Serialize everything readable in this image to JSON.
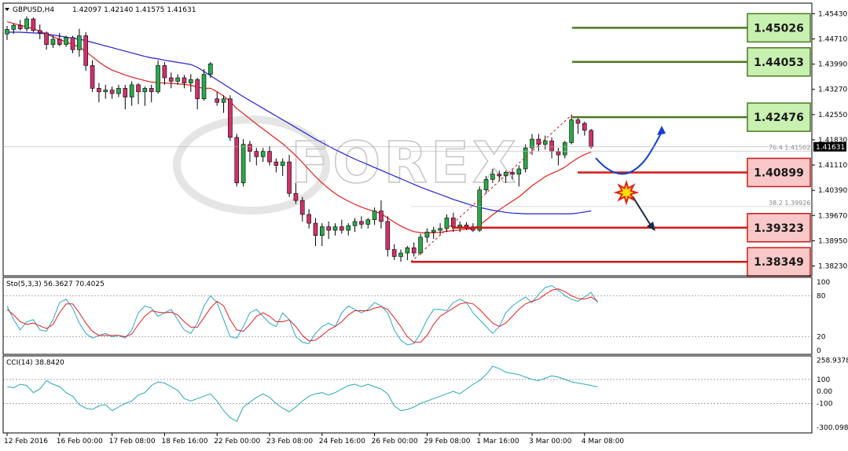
{
  "header": {
    "symbol": "GBPUSD,H4",
    "ohlc": "1.42097 1.42140 1.41575 1.41631"
  },
  "watermark": "FOREX",
  "chart_data": {
    "type": "candlestick",
    "symbol": "GBPUSD",
    "timeframe": "H4",
    "price_axis": {
      "ylim": [
        1.3795,
        1.4573
      ],
      "ticks": [
        "1.45430",
        "1.44710",
        "1.43990",
        "1.43270",
        "1.42550",
        "1.41830",
        "1.41110",
        "1.40390",
        "1.39670",
        "1.38950",
        "1.38230"
      ],
      "current_price": "1.41631"
    },
    "time_axis": {
      "labels": [
        "12 Feb 2016",
        "16 Feb 00:00",
        "17 Feb 08:00",
        "18 Feb 16:00",
        "22 Feb 00:00",
        "23 Feb 08:00",
        "24 Feb 16:00",
        "26 Feb 00:00",
        "29 Feb 08:00",
        "1 Mar 16:00",
        "3 Mar 00:00",
        "4 Mar 08:00"
      ],
      "label_bar_index": [
        0,
        8,
        16,
        24,
        32,
        40,
        48,
        56,
        64,
        72,
        80,
        88
      ]
    },
    "candles": [
      [
        1.4485,
        1.4508,
        1.4468,
        1.4498
      ],
      [
        1.4498,
        1.4515,
        1.4486,
        1.451
      ],
      [
        1.451,
        1.4525,
        1.4495,
        1.45
      ],
      [
        1.45,
        1.4535,
        1.4492,
        1.4528
      ],
      [
        1.4528,
        1.4532,
        1.449,
        1.4495
      ],
      [
        1.4495,
        1.4512,
        1.447,
        1.4488
      ],
      [
        1.4488,
        1.4492,
        1.444,
        1.4455
      ],
      [
        1.4455,
        1.448,
        1.4445,
        1.447
      ],
      [
        1.447,
        1.4488,
        1.445,
        1.4455
      ],
      [
        1.4455,
        1.448,
        1.4448,
        1.4475
      ],
      [
        1.4475,
        1.448,
        1.443,
        1.444
      ],
      [
        1.444,
        1.45,
        1.442,
        1.448
      ],
      [
        1.448,
        1.449,
        1.438,
        1.4395
      ],
      [
        1.4395,
        1.441,
        1.432,
        1.433
      ],
      [
        1.433,
        1.4345,
        1.429,
        1.432
      ],
      [
        1.432,
        1.434,
        1.43,
        1.4325
      ],
      [
        1.4325,
        1.4335,
        1.43,
        1.4315
      ],
      [
        1.4315,
        1.434,
        1.4305,
        1.433
      ],
      [
        1.433,
        1.434,
        1.427,
        1.4305
      ],
      [
        1.4305,
        1.435,
        1.428,
        1.434
      ],
      [
        1.434,
        1.4345,
        1.4285,
        1.432
      ],
      [
        1.432,
        1.4335,
        1.428,
        1.433
      ],
      [
        1.433,
        1.434,
        1.429,
        1.432
      ],
      [
        1.432,
        1.441,
        1.4315,
        1.4395
      ],
      [
        1.4395,
        1.4405,
        1.434,
        1.436
      ],
      [
        1.436,
        1.4375,
        1.433,
        1.435
      ],
      [
        1.435,
        1.437,
        1.434,
        1.436
      ],
      [
        1.436,
        1.4368,
        1.433,
        1.4345
      ],
      [
        1.4345,
        1.437,
        1.432,
        1.4355
      ],
      [
        1.4355,
        1.436,
        1.427,
        1.43
      ],
      [
        1.43,
        1.4385,
        1.4295,
        1.437
      ],
      [
        1.437,
        1.4405,
        1.436,
        1.44
      ],
      [
        1.43,
        1.432,
        1.428,
        1.429
      ],
      [
        1.429,
        1.431,
        1.426,
        1.43
      ],
      [
        1.43,
        1.431,
        1.418,
        1.419
      ],
      [
        1.419,
        1.42,
        1.405,
        1.406
      ],
      [
        1.406,
        1.4185,
        1.405,
        1.417
      ],
      [
        1.417,
        1.418,
        1.412,
        1.415
      ],
      [
        1.415,
        1.416,
        1.411,
        1.4135
      ],
      [
        1.4135,
        1.416,
        1.412,
        1.415
      ],
      [
        1.415,
        1.4165,
        1.411,
        1.412
      ],
      [
        1.412,
        1.413,
        1.409,
        1.411
      ],
      [
        1.411,
        1.413,
        1.408,
        1.412
      ],
      [
        1.412,
        1.414,
        1.402,
        1.403
      ],
      [
        1.403,
        1.406,
        1.4,
        1.401
      ],
      [
        1.401,
        1.402,
        1.395,
        1.397
      ],
      [
        1.397,
        1.3985,
        1.393,
        1.3945
      ],
      [
        1.3945,
        1.396,
        1.388,
        1.391
      ],
      [
        1.391,
        1.3945,
        1.388,
        1.3935
      ],
      [
        1.3935,
        1.395,
        1.39,
        1.3925
      ],
      [
        1.3925,
        1.3945,
        1.391,
        1.3935
      ],
      [
        1.3935,
        1.3955,
        1.3915,
        1.3925
      ],
      [
        1.3925,
        1.3945,
        1.391,
        1.3938
      ],
      [
        1.3938,
        1.396,
        1.392,
        1.395
      ],
      [
        1.395,
        1.3965,
        1.393,
        1.3942
      ],
      [
        1.3942,
        1.396,
        1.393,
        1.3955
      ],
      [
        1.3955,
        1.399,
        1.394,
        1.398
      ],
      [
        1.398,
        1.401,
        1.393,
        1.395
      ],
      [
        1.395,
        1.3965,
        1.385,
        1.387
      ],
      [
        1.387,
        1.3885,
        1.384,
        1.385
      ],
      [
        1.385,
        1.387,
        1.3835,
        1.386
      ],
      [
        1.386,
        1.388,
        1.384,
        1.3875
      ],
      [
        1.3875,
        1.389,
        1.385,
        1.386
      ],
      [
        1.386,
        1.3915,
        1.3855,
        1.3905
      ],
      [
        1.3905,
        1.393,
        1.389,
        1.392
      ],
      [
        1.392,
        1.3935,
        1.39,
        1.3925
      ],
      [
        1.3925,
        1.3945,
        1.391,
        1.393
      ],
      [
        1.393,
        1.397,
        1.392,
        1.396
      ],
      [
        1.396,
        1.3975,
        1.392,
        1.3935
      ],
      [
        1.3935,
        1.395,
        1.392,
        1.394
      ],
      [
        1.394,
        1.3948,
        1.3925,
        1.3935
      ],
      [
        1.3935,
        1.3945,
        1.392,
        1.3925
      ],
      [
        1.3925,
        1.405,
        1.392,
        1.404
      ],
      [
        1.404,
        1.408,
        1.403,
        1.407
      ],
      [
        1.407,
        1.41,
        1.406,
        1.4085
      ],
      [
        1.4085,
        1.4095,
        1.4065,
        1.408
      ],
      [
        1.408,
        1.4095,
        1.406,
        1.409
      ],
      [
        1.409,
        1.41,
        1.407,
        1.4085
      ],
      [
        1.4085,
        1.411,
        1.405,
        1.41
      ],
      [
        1.41,
        1.417,
        1.409,
        1.416
      ],
      [
        1.416,
        1.42,
        1.414,
        1.4185
      ],
      [
        1.4185,
        1.42,
        1.415,
        1.417
      ],
      [
        1.417,
        1.4195,
        1.4155,
        1.418
      ],
      [
        1.418,
        1.419,
        1.413,
        1.415
      ],
      [
        1.415,
        1.416,
        1.411,
        1.414
      ],
      [
        1.414,
        1.418,
        1.413,
        1.4175
      ],
      [
        1.4175,
        1.4255,
        1.417,
        1.424
      ],
      [
        1.424,
        1.425,
        1.42,
        1.423
      ],
      [
        1.423,
        1.4235,
        1.4195,
        1.421
      ],
      [
        1.421,
        1.4214,
        1.4158,
        1.4163
      ]
    ],
    "indicators": {
      "ma_fast": {
        "color": "#e02020",
        "values": [
          1.452,
          1.4515,
          1.451,
          1.4505,
          1.45,
          1.4493,
          1.4485,
          1.4477,
          1.447,
          1.4462,
          1.4455,
          1.4448,
          1.4435,
          1.442,
          1.4405,
          1.4392,
          1.4382,
          1.4375,
          1.4368,
          1.4362,
          1.4357,
          1.4352,
          1.4348,
          1.4346,
          1.4345,
          1.4344,
          1.4343,
          1.4341,
          1.4339,
          1.4333,
          1.433,
          1.433,
          1.432,
          1.4308,
          1.4292,
          1.4272,
          1.4258,
          1.4243,
          1.4228,
          1.4214,
          1.42,
          1.4186,
          1.4172,
          1.4155,
          1.4138,
          1.4118,
          1.4098,
          1.4078,
          1.406,
          1.4044,
          1.403,
          1.4018,
          1.4008,
          1.3999,
          1.3991,
          1.3984,
          1.3979,
          1.3972,
          1.396,
          1.3948,
          1.3937,
          1.3928,
          1.3921,
          1.3918,
          1.3917,
          1.3918,
          1.3919,
          1.3922,
          1.3924,
          1.3926,
          1.3928,
          1.3929,
          1.394,
          1.3954,
          1.3969,
          1.3983,
          1.3996,
          1.4008,
          1.402,
          1.4036,
          1.4052,
          1.4065,
          1.4078,
          1.4087,
          1.4095,
          1.4105,
          1.4119,
          1.4131,
          1.4141,
          1.4148
        ]
      },
      "ma_slow": {
        "color": "#2020d0",
        "values": [
          1.449,
          1.449,
          1.449,
          1.4489,
          1.4488,
          1.4487,
          1.4485,
          1.4482,
          1.4479,
          1.4476,
          1.4473,
          1.447,
          1.4466,
          1.4461,
          1.4456,
          1.4451,
          1.4446,
          1.4441,
          1.4436,
          1.4431,
          1.4426,
          1.4421,
          1.4417,
          1.4414,
          1.441,
          1.4407,
          1.4404,
          1.4401,
          1.4398,
          1.439,
          1.4378,
          1.4366,
          1.4354,
          1.4342,
          1.433,
          1.4318,
          1.4306,
          1.4295,
          1.4284,
          1.4273,
          1.4262,
          1.4251,
          1.424,
          1.4229,
          1.4218,
          1.4207,
          1.4196,
          1.4185,
          1.4175,
          1.4165,
          1.4155,
          1.4146,
          1.4137,
          1.4128,
          1.412,
          1.4112,
          1.4104,
          1.4096,
          1.4088,
          1.408,
          1.4072,
          1.4064,
          1.4056,
          1.4048,
          1.4041,
          1.4034,
          1.4027,
          1.402,
          1.4013,
          1.4007,
          1.4001,
          1.3995,
          1.399,
          1.3986,
          1.3982,
          1.3979,
          1.3976,
          1.3974,
          1.3973,
          1.3972,
          1.3972,
          1.3972,
          1.3972,
          1.3972,
          1.3972,
          1.3972,
          1.3972,
          1.3974,
          1.3977,
          1.398
        ]
      }
    },
    "levels": [
      {
        "label": "1.45026",
        "value": 1.45026,
        "kind": "resistance",
        "color": "#4a7a20",
        "fill": "#c8f0b0"
      },
      {
        "label": "1.44053",
        "value": 1.44053,
        "kind": "resistance",
        "color": "#4a7a20",
        "fill": "#c8f0b0"
      },
      {
        "label": "1.42476",
        "value": 1.42476,
        "kind": "resistance",
        "color": "#4a7a20",
        "fill": "#c8f0b0"
      },
      {
        "label": "1.40899",
        "value": 1.40899,
        "kind": "support",
        "color": "#d01818",
        "fill": "#f8c8c8"
      },
      {
        "label": "1.39323",
        "value": 1.39323,
        "kind": "support",
        "color": "#d01818",
        "fill": "#f8c8c8"
      },
      {
        "label": "1.38349",
        "value": 1.38349,
        "kind": "support",
        "color": "#d01818",
        "fill": "#f8c8c8"
      }
    ],
    "fibonacci": [
      {
        "label": "76.4",
        "price": "1.41502",
        "value": 1.41502
      },
      {
        "label": "38.2",
        "price": "1.39926",
        "value": 1.39926
      }
    ],
    "stochastic": {
      "label": "Sto(5,3,3) 56.3627 70.4025",
      "ylim": [
        0,
        100
      ],
      "ticks": [
        "100",
        "80",
        "20",
        "0"
      ],
      "levels": [
        80,
        20
      ],
      "k": [
        65,
        45,
        30,
        42,
        45,
        30,
        28,
        45,
        70,
        75,
        62,
        40,
        25,
        18,
        22,
        25,
        20,
        22,
        18,
        30,
        55,
        65,
        62,
        50,
        55,
        60,
        45,
        30,
        25,
        40,
        65,
        80,
        70,
        45,
        20,
        18,
        35,
        55,
        60,
        50,
        40,
        35,
        55,
        45,
        20,
        12,
        10,
        25,
        35,
        40,
        35,
        55,
        65,
        60,
        55,
        60,
        70,
        65,
        55,
        30,
        15,
        8,
        10,
        25,
        45,
        60,
        60,
        58,
        70,
        75,
        70,
        55,
        45,
        35,
        25,
        35,
        55,
        65,
        72,
        78,
        70,
        82,
        92,
        95,
        88,
        80,
        75,
        72,
        78,
        85,
        70
      ],
      "d": [
        60,
        52,
        42,
        38,
        40,
        36,
        32,
        38,
        55,
        68,
        68,
        55,
        40,
        28,
        22,
        22,
        22,
        22,
        20,
        24,
        38,
        50,
        58,
        56,
        55,
        56,
        52,
        42,
        34,
        34,
        48,
        62,
        72,
        65,
        45,
        30,
        28,
        38,
        50,
        55,
        50,
        42,
        42,
        45,
        35,
        22,
        14,
        15,
        22,
        30,
        35,
        42,
        52,
        58,
        58,
        58,
        62,
        64,
        60,
        48,
        35,
        20,
        12,
        12,
        22,
        38,
        50,
        56,
        62,
        68,
        70,
        68,
        60,
        50,
        40,
        35,
        40,
        50,
        60,
        68,
        72,
        75,
        82,
        88,
        90,
        86,
        80,
        76,
        75,
        78,
        72
      ]
    },
    "cci": {
      "label": "CCI(14) 38.8420",
      "ylim": [
        -320,
        270
      ],
      "ticks": [
        "258.9378",
        "100",
        "0.00",
        "-100",
        "-300.098"
      ],
      "levels": [
        100,
        -100
      ],
      "values": [
        40,
        30,
        60,
        50,
        -10,
        20,
        90,
        60,
        40,
        -10,
        -40,
        -110,
        -140,
        -150,
        -120,
        -110,
        -160,
        -130,
        -100,
        -80,
        -30,
        -10,
        50,
        80,
        70,
        40,
        10,
        -60,
        -80,
        -60,
        -40,
        -20,
        -80,
        -160,
        -220,
        -250,
        -130,
        -90,
        -50,
        -20,
        -50,
        -100,
        -140,
        -170,
        -130,
        -80,
        -40,
        -20,
        -10,
        -30,
        -10,
        20,
        50,
        60,
        40,
        60,
        40,
        20,
        -20,
        -120,
        -160,
        -150,
        -130,
        -100,
        -80,
        -60,
        -40,
        -20,
        0,
        -20,
        20,
        60,
        90,
        140,
        210,
        190,
        160,
        150,
        140,
        120,
        100,
        90,
        110,
        130,
        120,
        100,
        80,
        70,
        60,
        50,
        38.84
      ]
    }
  }
}
